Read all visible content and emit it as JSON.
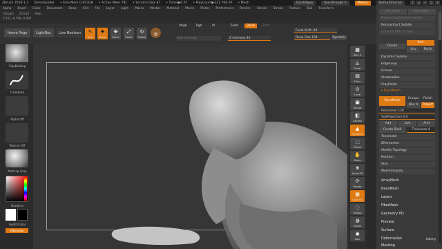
{
  "titlebar": {
    "app": "ZBrush 2019.1.2",
    "doc": "DemoSoldier",
    "stats": [
      "• Free Mem 0.853GB",
      "• Active Mem 781",
      "• Scratch Disk 87",
      "• Timer▶0.07",
      "• PolyCount▶221.706 KP",
      "• Mesh"
    ],
    "quicksave": "QuickSave",
    "seethrough": "See-through  0",
    "menus_btn": "Menus",
    "script_btn": "DefaultZScript",
    "controls": [
      "?",
      "▭",
      "—",
      "▢",
      "✕"
    ]
  },
  "menubar": [
    "Alpha",
    "Brush",
    "Color",
    "Document",
    "Draw",
    "Edit",
    "File",
    "Layer",
    "Light",
    "Macro",
    "Marker",
    "Material",
    "Movie",
    "Picker",
    "Preferences",
    "Render",
    "Stencil",
    "Stroke",
    "Texture",
    "Tool",
    "Transform"
  ],
  "subrow": [
    "Zplugin",
    "Zscript",
    "Help"
  ],
  "coords": "0.161,-0.598,-0.097",
  "toolbar": {
    "home": "Home Page",
    "lightbox": "LightBox",
    "live_boolean": "Live Boolean",
    "edit": "Edit",
    "draw": "Draw",
    "move": "Move",
    "scale": "Scale",
    "rotate": "Rotate",
    "mrgb": "Mrgb",
    "rgb": "Rgb",
    "m": "M",
    "rgb_intensity": "Rgb Intensity",
    "zadd": "Zadd",
    "zsub": "Zsub",
    "zcut": "Zcut",
    "z_intensity": "Z Intensity  45",
    "focal_shift": "Focal Shift  -98",
    "draw_size": "Draw Size  104",
    "dynamic": "Dynamic"
  },
  "leftshelf": {
    "brush1": "ClayBuildup",
    "brush2": "FreeHand",
    "alpha": "Alpha Off",
    "texture": "Texture Off",
    "material": "MatCap Gray",
    "gradient": "Gradient",
    "switchcolor": "SwitchColor",
    "alternate": "Alternate"
  },
  "rightshelf": [
    "SPix 3",
    "Persp",
    "Floor",
    "Local",
    "Actual",
    "AAHalf",
    "Dynamic",
    "Frame",
    "Move",
    "Zoom3D",
    "Rotate",
    "Line Fill",
    "Transp",
    "Ghost",
    "Solo",
    "Xpose"
  ],
  "panel": {
    "top_rows": [
      "Del Lower",
      "Del Higher",
      "Freeze SubDivision Levels",
      "Reconstruct Subdiv",
      "Convert BPR To Geo"
    ],
    "divide": "Divide",
    "smt": "Smt",
    "suv": "Suv",
    "reuv": "ReUV",
    "rows": [
      "Dynamic Subdiv",
      "EdgeLoop",
      "Crease",
      "ShadowBox",
      "ClayPolish"
    ],
    "dynamesh_hdr": "DynaMesh",
    "dynamesh_btn": "DynaMesh",
    "groups": "Groups",
    "polish": "Polish",
    "blur": "Blur  4",
    "project": "Project",
    "resolution": "Resolution  128",
    "subprojection": "SubProjection  0.6",
    "add": "Add",
    "sub": "Sub",
    "and": "And",
    "create_shell": "Create Shell",
    "thickness": "Thickness  4",
    "rows2": [
      "Tessimate",
      "ZRemesher",
      "Modify Topology",
      "Position",
      "Size",
      "MeshIntegrity"
    ],
    "subpalettes": [
      "ArrayMesh",
      "NanoMesh",
      "Layers",
      "FiberMesh",
      "Geometry HD",
      "Preview",
      "Surface",
      "Deformation",
      "Masking"
    ]
  },
  "logo_text": "Udemy"
}
